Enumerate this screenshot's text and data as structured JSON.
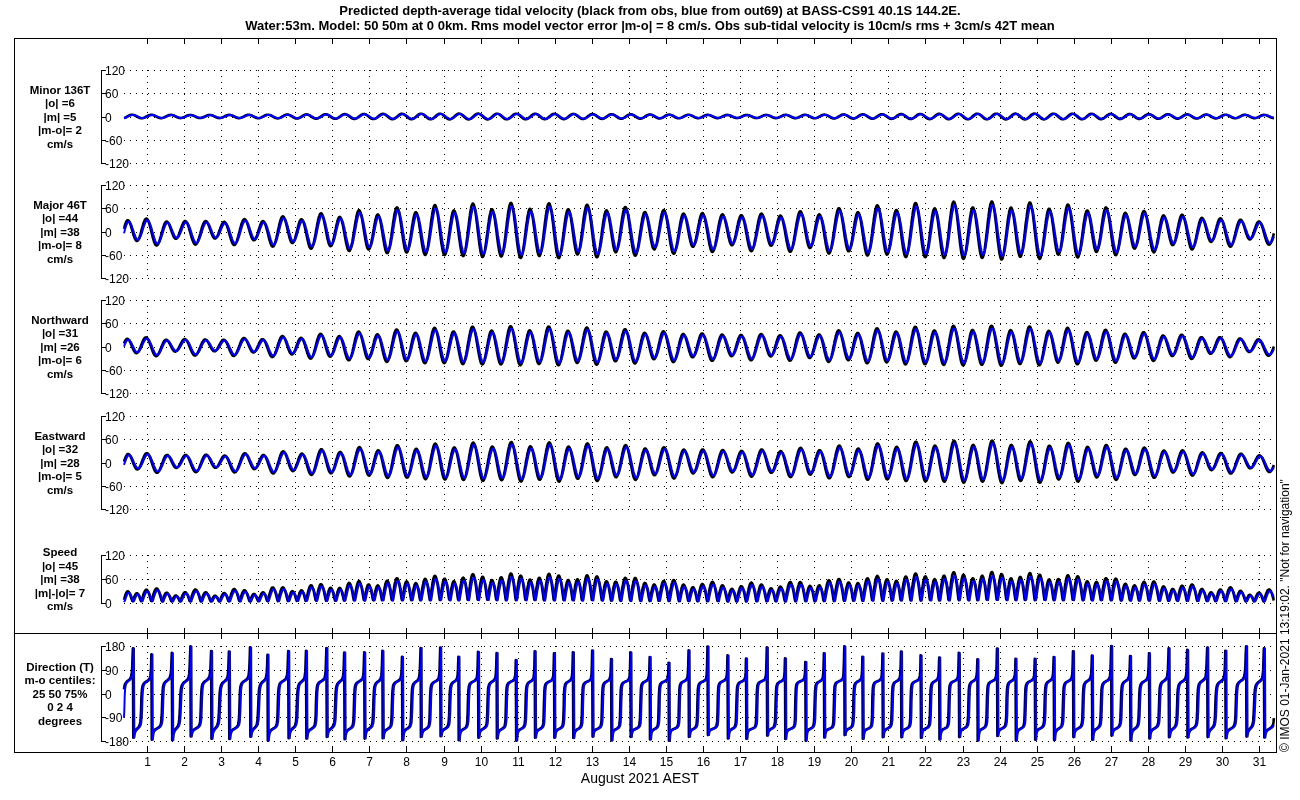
{
  "title_lines": [
    "Predicted depth-average tidal velocity (black from obs, blue from out69) at BASS-CS91 40.1S 144.2E.",
    "Water:53m. Model: 50 50m at 0 0km. Rms model vector error |m-o| = 8 cm/s. Obs sub-tidal velocity is 10cm/s rms + 3cm/s 42T mean"
  ],
  "panels": [
    {
      "kind": "minor",
      "legend": [
        "Minor 136T",
        "|o| =6",
        "|m| =5",
        "|m-o|= 2",
        "cm/s"
      ],
      "ytick_labels": [
        "120",
        "60",
        "0",
        "-60",
        "-120"
      ]
    },
    {
      "kind": "major",
      "legend": [
        "Major 46T",
        "|o| =44",
        "|m| =38",
        "|m-o|= 8",
        "cm/s"
      ],
      "ytick_labels": [
        "120",
        "60",
        "0",
        "-60",
        "-120"
      ]
    },
    {
      "kind": "north",
      "legend": [
        "Northward",
        "|o| =31",
        "|m| =26",
        "|m-o|= 6",
        "cm/s"
      ],
      "ytick_labels": [
        "120",
        "60",
        "0",
        "-60",
        "-120"
      ]
    },
    {
      "kind": "east",
      "legend": [
        "Eastward",
        "|o| =32",
        "|m| =28",
        "|m-o|= 5",
        "cm/s"
      ],
      "ytick_labels": [
        "120",
        "60",
        "0",
        "-60",
        "-120"
      ]
    },
    {
      "kind": "speed",
      "legend": [
        "Speed",
        "|o| =45",
        "|m| =38",
        "|m|-|o|= 7",
        "cm/s"
      ],
      "ytick_labels": [
        "120",
        "60",
        "0"
      ]
    },
    {
      "kind": "direction",
      "legend": [
        "Direction (T)",
        "m-o centiles:",
        "25  50  75%",
        "0  2  4",
        "degrees"
      ],
      "ytick_labels": [
        "180",
        "90",
        "0",
        "-90",
        "-180"
      ]
    }
  ],
  "xtick_labels": [
    "1",
    "2",
    "3",
    "4",
    "5",
    "6",
    "7",
    "8",
    "9",
    "10",
    "11",
    "12",
    "13",
    "14",
    "15",
    "16",
    "17",
    "18",
    "19",
    "20",
    "21",
    "22",
    "23",
    "24",
    "25",
    "26",
    "27",
    "28",
    "29",
    "30",
    "31"
  ],
  "xlabel": "August 2021 AEST",
  "side_note": "© IMOS 01-Jan-2021 13:19:02. \"Not for navigation\""
}
